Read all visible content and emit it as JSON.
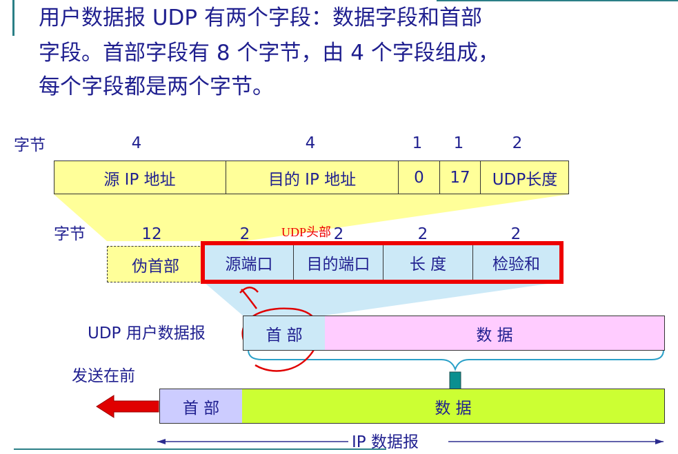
{
  "heading": {
    "line1": "用户数据报 UDP 有两个字段：数据字段和首部",
    "line2": "字段。首部字段有 8 个字节，由 4 个字段组成，",
    "line3": "每个字段都是两个字节。"
  },
  "pseudo_header": {
    "bytes_label": "字节",
    "byte_counts": [
      "4",
      "4",
      "1",
      "1",
      "2"
    ],
    "fields": [
      "源 IP 地址",
      "目的 IP 地址",
      "0",
      "17",
      "UDP长度"
    ]
  },
  "udp_header": {
    "bytes_label": "字节",
    "byte_counts": [
      "12",
      "2",
      "2",
      "2",
      "2"
    ],
    "pseudo_label": "伪首部",
    "fields": [
      "源端口",
      "目的端口",
      "长  度",
      "检验和"
    ],
    "annotation": "UDP头部"
  },
  "udp_datagram": {
    "label": "UDP 用户数据报",
    "header": "首  部",
    "data": "数        据"
  },
  "ip_datagram": {
    "send_first_label": "发送在前",
    "header": "首  部",
    "data": "数        据",
    "label": "IP 数据报"
  }
}
